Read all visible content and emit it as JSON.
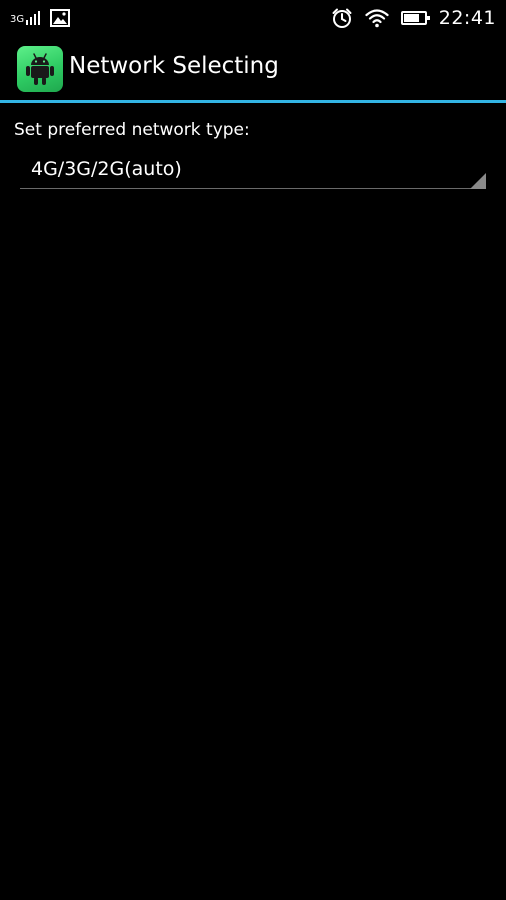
{
  "status_bar": {
    "network_type": "3G",
    "signal_icon": "signal-bars-icon",
    "gallery_icon": "image-notification-icon",
    "alarm_icon": "alarm-clock-icon",
    "wifi_icon": "wifi-icon",
    "battery_icon": "battery-icon",
    "battery_level": 0.75,
    "time": "22:41"
  },
  "action_bar": {
    "app_icon": "android-robot-icon",
    "title": "Network Selecting",
    "accent_color": "#33b5e5"
  },
  "content": {
    "preferred_label": "Set preferred network type:",
    "spinner": {
      "selected": "4G/3G/2G(auto)"
    }
  }
}
